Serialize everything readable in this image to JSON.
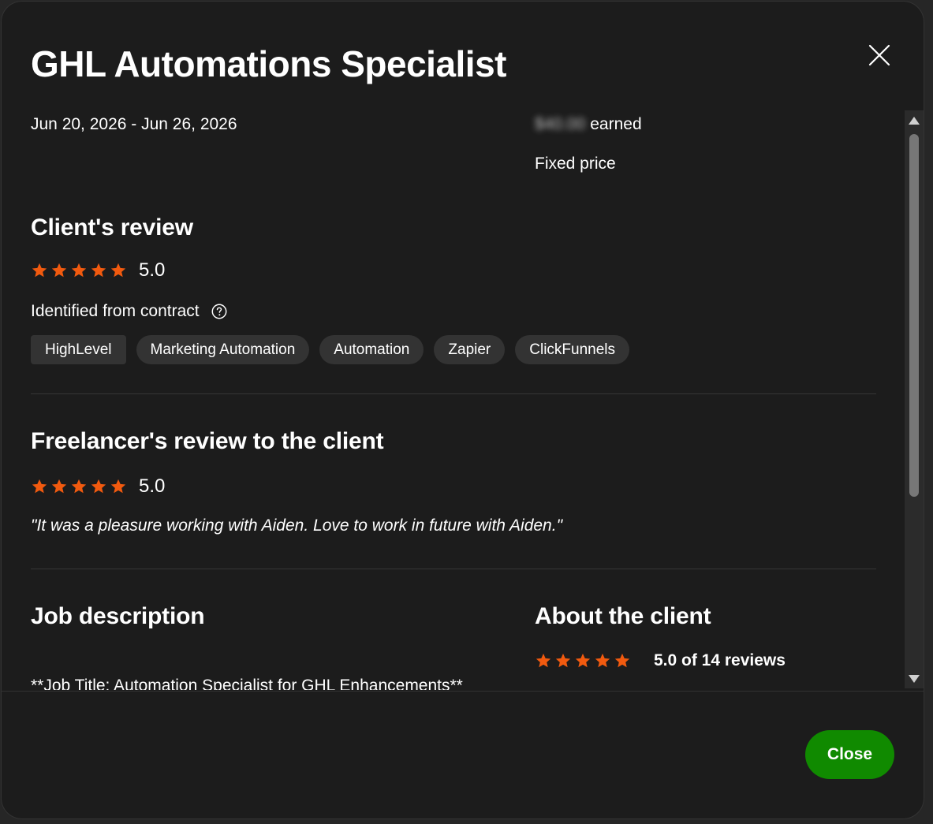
{
  "modal": {
    "title": "GHL Automations Specialist",
    "date_range": "Jun 20, 2026 - Jun 26, 2026",
    "amount": "$40.00",
    "earned_label": "earned",
    "price_type": "Fixed price",
    "close_button_label": "Close",
    "close_icon": "close-icon"
  },
  "client_review": {
    "heading": "Client's review",
    "rating": "5.0",
    "stars": 5,
    "identified_label": "Identified from contract",
    "skills": [
      "HighLevel",
      "Marketing Automation",
      "Automation",
      "Zapier",
      "ClickFunnels"
    ]
  },
  "freelancer_review": {
    "heading": "Freelancer's review to the client",
    "rating": "5.0",
    "stars": 5,
    "quote": "\"It was a pleasure working with Aiden. Love to work in future with Aiden.\""
  },
  "job_description": {
    "heading": "Job description",
    "text": "**Job Title: Automation Specialist for GHL Enhancements**"
  },
  "about_client": {
    "heading": "About the client",
    "stars": 5,
    "rating_text": "5.0 of 14 reviews"
  },
  "colors": {
    "star": "#f15a0f",
    "accent_green": "#108a00",
    "modal_bg": "#1c1c1c",
    "chip_bg": "#333333"
  }
}
